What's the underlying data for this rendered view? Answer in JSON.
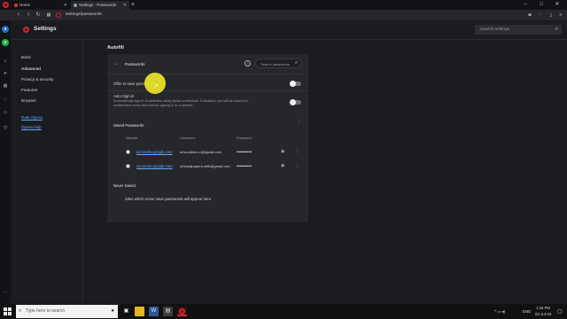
{
  "browser": {
    "tabs": [
      {
        "label": "Home",
        "active": false
      },
      {
        "label": "Settings - Passwords",
        "active": true
      }
    ],
    "new_tab_label": "+",
    "url": "settings/passwords",
    "window_controls": {
      "minimize": "–",
      "maximize": "□",
      "close": "✕"
    }
  },
  "settings": {
    "title": "Settings",
    "search_placeholder": "Search settings",
    "nav": {
      "basic": "Basic",
      "advanced": "Advanced",
      "privacy": "Privacy & security",
      "features": "Features",
      "browser": "Browser",
      "rate": "Rate Opera",
      "help": "Opera help"
    }
  },
  "autofill": {
    "section_title": "Autofill",
    "page_title": "Passwords",
    "search_placeholder": "Search passwords",
    "offer_to_save": {
      "label": "Offer to save passwords",
      "enabled": false
    },
    "auto_sign_in": {
      "label": "Auto Sign-in",
      "description_line1": "Automatically sign in to websites using stored credentials. If disabled, you will be asked for",
      "description_line2": "confirmation every time before signing in to a website.",
      "enabled": false
    },
    "saved_passwords": {
      "title": "Saved Passwords",
      "columns": {
        "website": "Website",
        "username": "Username",
        "password": "Password"
      },
      "rows": [
        {
          "website": "accounts.google.com",
          "username": "a2zcodebs.co@gmail.com",
          "password": "••••••••••••••"
        },
        {
          "website": "accounts.google.com",
          "username": "a2zwallpapers.net6@gmail.com",
          "password": "••••••••••••••"
        }
      ]
    },
    "never_saved": {
      "title": "Never Saved",
      "empty_message": "Sites which never save passwords will appear here"
    }
  },
  "taskbar": {
    "search_placeholder": "Type here to search",
    "language": "ENG",
    "time": "1:34 PM",
    "date": "02-Jul-19"
  },
  "colors": {
    "accent_link": "#5fa8ff",
    "opera_red": "#e0202e",
    "card_bg": "#26272b",
    "cursor_highlight": "#ebe628"
  }
}
